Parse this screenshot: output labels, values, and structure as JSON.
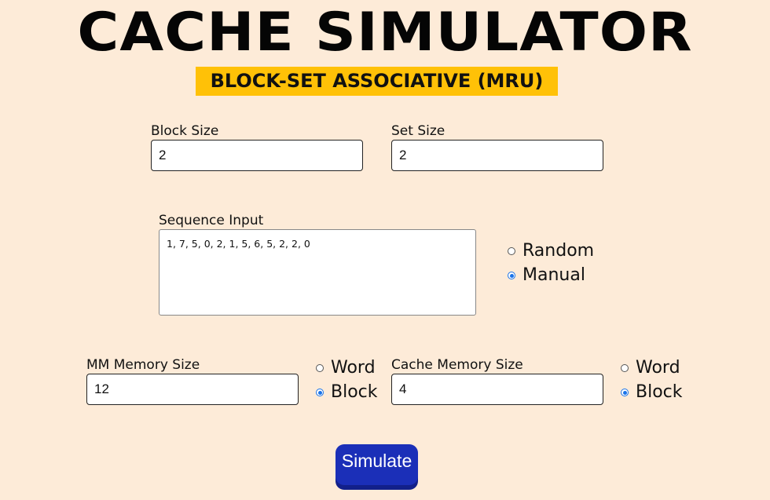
{
  "header": {
    "title": "CACHE SIMULATOR",
    "subtitle": "BLOCK-SET ASSOCIATIVE (MRU)"
  },
  "block_size": {
    "label": "Block Size",
    "value": "2"
  },
  "set_size": {
    "label": "Set Size",
    "value": "2"
  },
  "sequence": {
    "label": "Sequence Input",
    "value": "1, 7, 5, 0, 2, 1, 5, 6, 5, 2, 2, 0",
    "options": [
      {
        "label": "Random",
        "checked": false
      },
      {
        "label": "Manual",
        "checked": true
      }
    ]
  },
  "mm_memory": {
    "label": "MM Memory Size",
    "value": "12",
    "units": [
      {
        "label": "Word",
        "checked": false
      },
      {
        "label": "Block",
        "checked": true
      }
    ]
  },
  "cache_memory": {
    "label": "Cache Memory Size",
    "value": "4",
    "units": [
      {
        "label": "Word",
        "checked": false
      },
      {
        "label": "Block",
        "checked": true
      }
    ]
  },
  "actions": {
    "simulate_label": "Simulate"
  },
  "colors": {
    "background": "#fdebd8",
    "subtitle_bg": "#ffc107",
    "button_bg": "#1b2fb8",
    "radio_accent": "#1a73e8"
  }
}
